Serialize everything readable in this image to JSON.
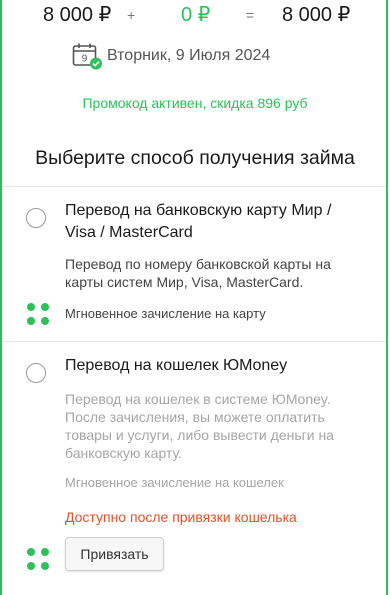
{
  "summary": {
    "principal": "8 000 ₽",
    "plus": "+",
    "fee": "0 ₽",
    "equals": "=",
    "total": "8 000 ₽"
  },
  "date": {
    "day_number": "9",
    "text": "Вторник, 9 Июля 2024",
    "icon": "calendar-check-icon"
  },
  "promo": "Промокод активен, скидка 896 руб",
  "section_title": "Выберите способ получения займа",
  "options": [
    {
      "title": "Перевод на банковскую карту Мир / Visa / MasterCard",
      "description": "Перевод по номеру банковской карты на карты систем Мир, Visa, MasterCard.",
      "speed": "Мгновенное зачисление на карту",
      "selected": false,
      "enabled": true
    },
    {
      "title": "Перевод на кошелек ЮMoney",
      "description": "Перевод на кошелек в системе ЮMoney. После зачисления, вы можете оплатить товары и услуги, либо вывести деньги на банковскую карту.",
      "speed": "Мгновенное зачисление на кошелек",
      "warning": "Доступно после привязки кошелька",
      "button_label": "Привязать",
      "selected": false,
      "enabled": false
    }
  ],
  "colors": {
    "accent": "#2ec05a",
    "warning": "#e0522b",
    "muted": "#a6a6a6"
  }
}
